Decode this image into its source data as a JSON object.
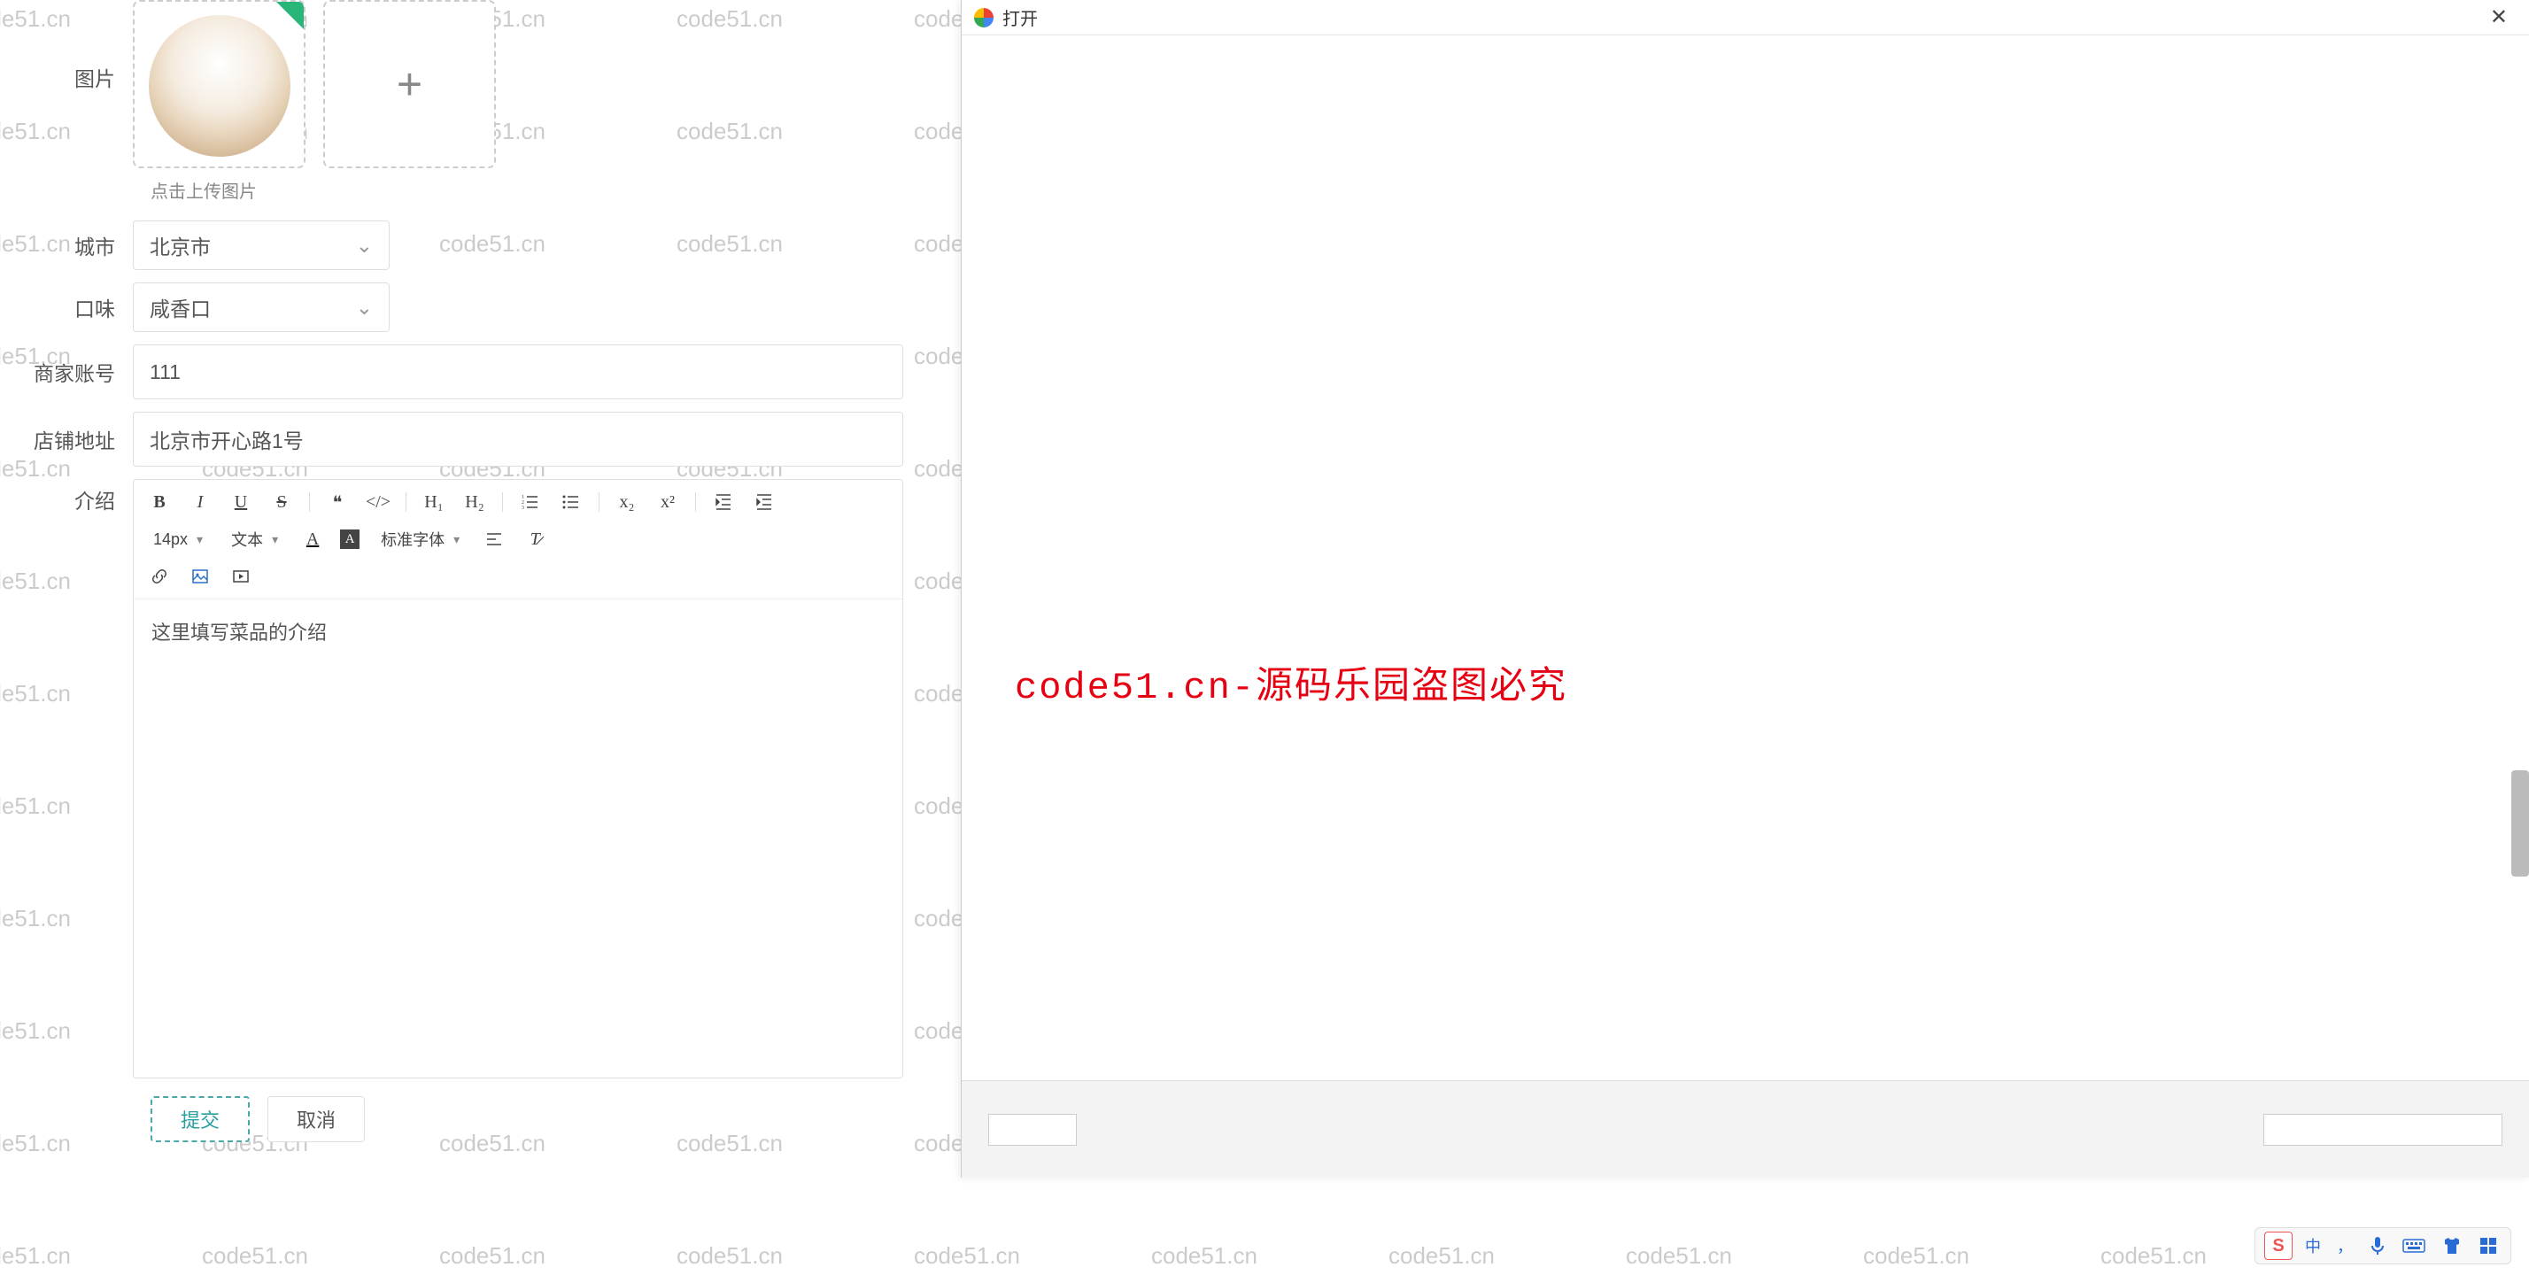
{
  "watermark_text": "code51.cn",
  "form": {
    "labels": {
      "image": "图片",
      "city": "城市",
      "taste": "口味",
      "merchant_account": "商家账号",
      "shop_address": "店铺地址",
      "intro": "介绍"
    },
    "upload_hint": "点击上传图片",
    "city_value": "北京市",
    "taste_value": "咸香口",
    "merchant_account_value": "111",
    "shop_address_value": "北京市开心路1号",
    "editor": {
      "font_size": "14px",
      "text_style": "文本",
      "font_family": "标准字体",
      "content": "这里填写菜品的介绍"
    },
    "buttons": {
      "submit": "提交",
      "cancel": "取消"
    }
  },
  "dialog": {
    "title": "打开",
    "center_text": "code51.cn-源码乐园盗图必究"
  },
  "ime": {
    "lang": "中",
    "punct": "，"
  }
}
